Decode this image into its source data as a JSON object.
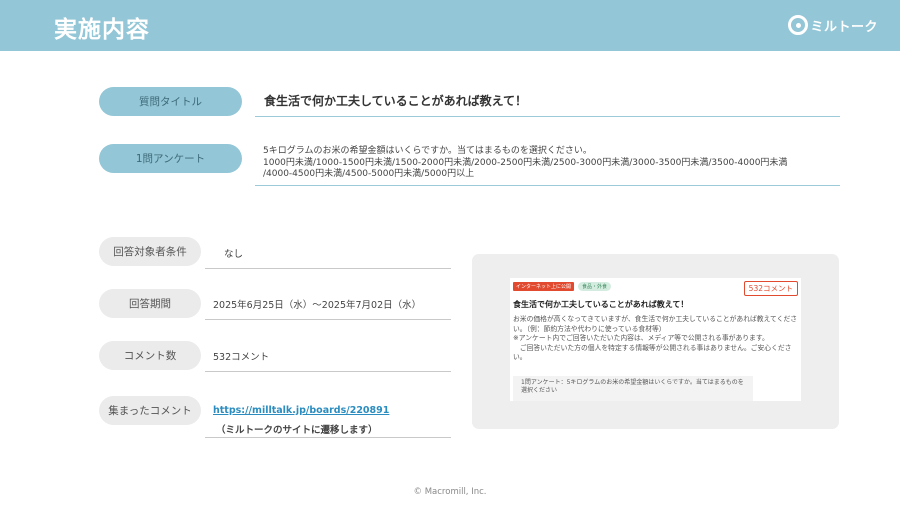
{
  "header": {
    "title": "実施内容",
    "brand": "ミルトーク"
  },
  "question": {
    "label": "質問タイトル",
    "value": "食生活で何か工夫していることがあれば教えて！"
  },
  "survey": {
    "label": "1問アンケート",
    "line1": "5キログラムのお米の希望金額はいくらですか。当てはまるものを選択ください。",
    "line2": "1000円未満/1000-1500円未満/1500-2000円未満/2000-2500円未満/2500-3000円未満/3000-3500円未満/3500-4000円未満",
    "line3": "/4000-4500円未満/4500-5000円未満/5000円以上"
  },
  "conditions": {
    "label": "回答対象者条件",
    "value": "なし"
  },
  "period": {
    "label": "回答期間",
    "value": "2025年6月25日（水）～2025年7月02日（水）"
  },
  "comments": {
    "label": "コメント数",
    "value": "532コメント"
  },
  "collected": {
    "label": "集まったコメント",
    "link": "https://milltalk.jp/boards/220891",
    "note": "（ミルトークのサイトに遷移します）"
  },
  "preview": {
    "badge_public": "インターネット上に公開",
    "badge_category": "食品・外食",
    "comment_count": "532コメント",
    "title": "食生活で何か工夫していることがあれば教えて！",
    "body1": "お米の価格が高くなってきていますが、食生活で何か工夫していることがあれば教えてください。（例：節約方法や代わりに使っている食材等）",
    "body2": "※アンケート内でご回答いただいた内容は、メディア等で公開される事があります。",
    "body3": "　ご回答いただいた方の個人を特定する情報等が公開される事はありません。ご安心ください。",
    "box": "1問アンケート：5キログラムのお米の希望金額はいくらですか。当てはまるものを選択ください"
  },
  "footer": {
    "copyright": "© Macromill, Inc."
  }
}
